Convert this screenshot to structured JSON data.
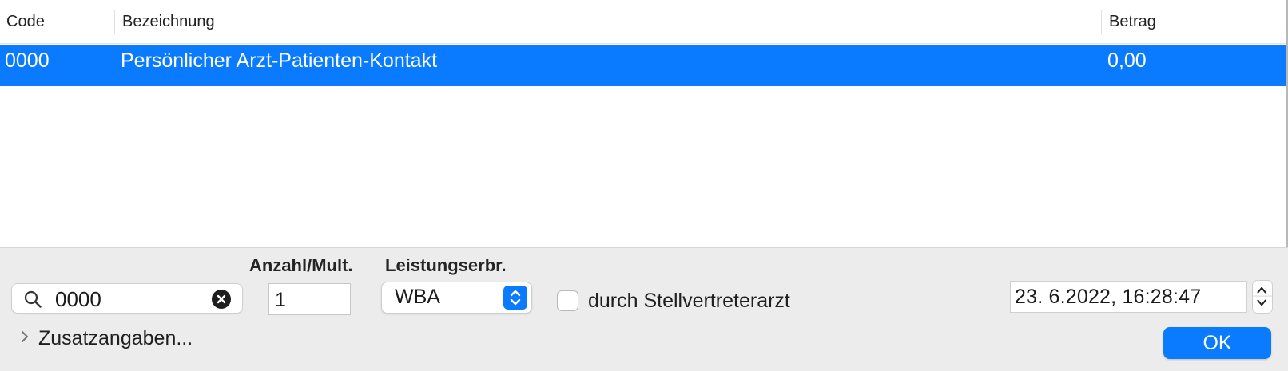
{
  "table": {
    "columns": [
      "Code",
      "Bezeichnung",
      "Betrag"
    ],
    "rows": [
      {
        "code": "0000",
        "bezeichnung": "Persönlicher Arzt-Patienten-Kontakt",
        "betrag": "0,00",
        "selected": true
      }
    ]
  },
  "form": {
    "search_value": "0000",
    "anzahl_label": "Anzahl/Mult.",
    "anzahl_value": "1",
    "leistung_label": "Leistungserbr.",
    "leistung_value": "WBA",
    "stellvertreter_label": "durch Stellvertreterarzt",
    "stellvertreter_checked": false,
    "datetime_value": "23.  6.2022, 16:28:47",
    "zusatz_label": "Zusatzangaben...",
    "ok_label": "OK"
  },
  "icons": {
    "search": "search-icon",
    "clear": "clear-icon",
    "select": "chevron-up-down-icon",
    "stepper": "stepper-icon",
    "disclosure": "chevron-right-icon"
  },
  "colors": {
    "accent": "#0a7aff",
    "panel": "#ececec"
  }
}
